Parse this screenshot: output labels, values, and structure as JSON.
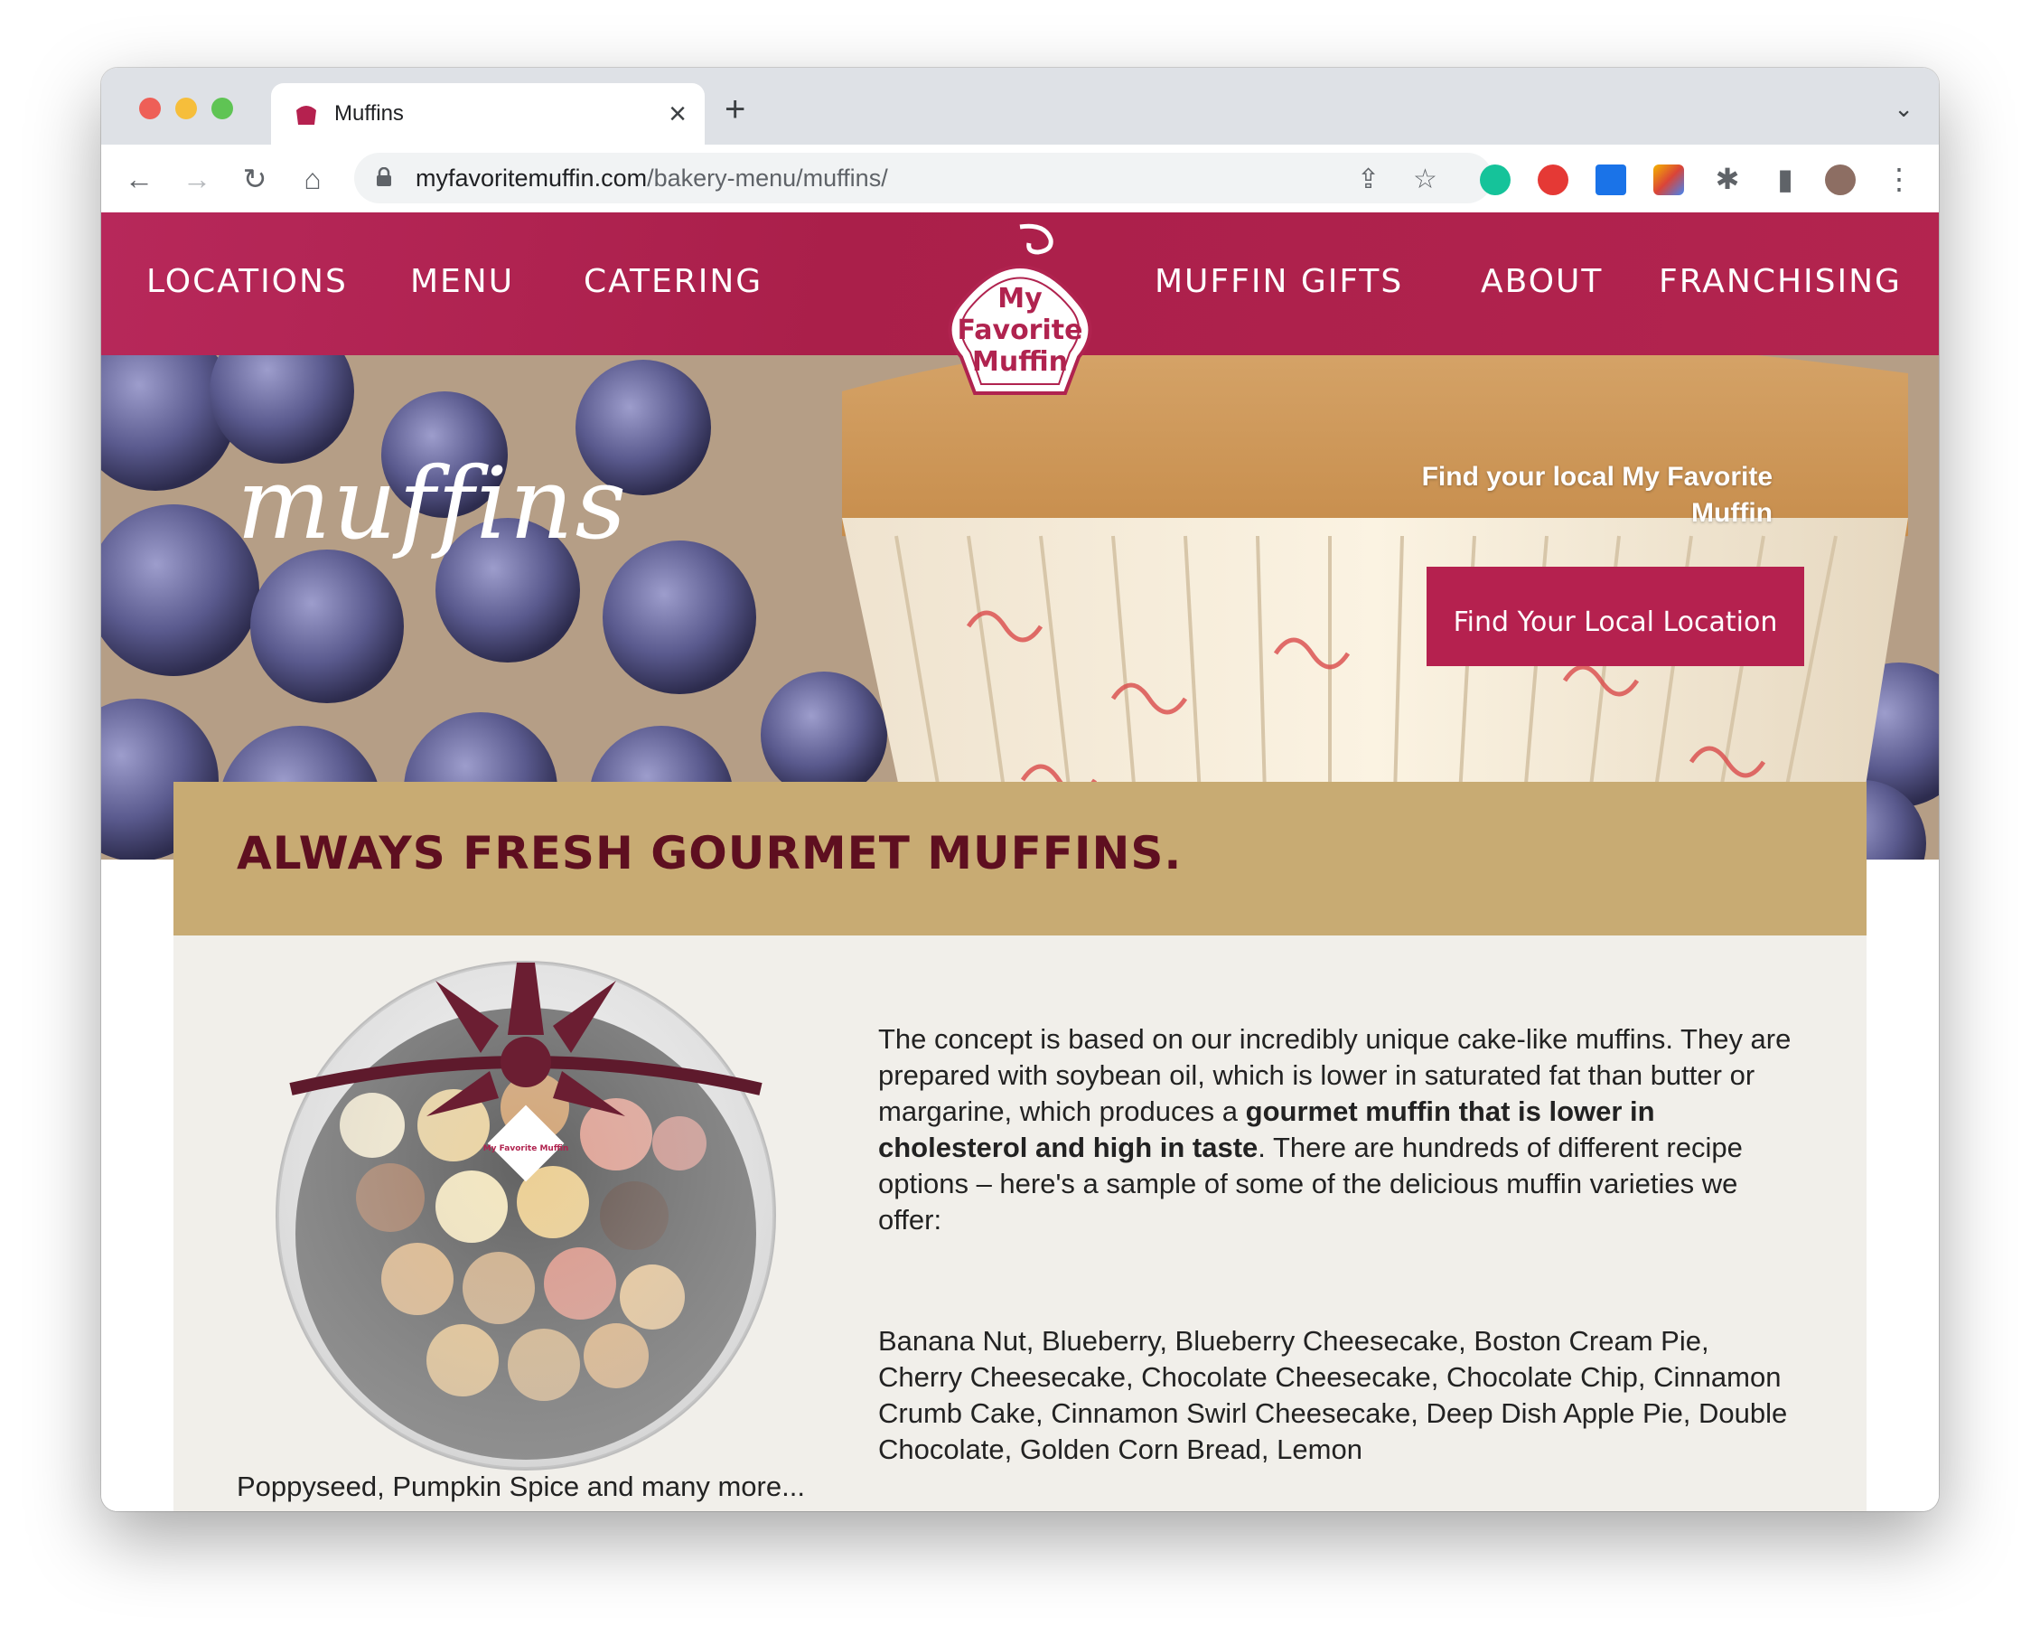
{
  "browser": {
    "tab_title": "Muffins",
    "url_domain": "myfavoritemuffin.com",
    "url_path": "/bakery-menu/muffins/"
  },
  "nav": {
    "locations": "LOCATIONS",
    "menu": "MENU",
    "catering": "CATERING",
    "muffin_gifts": "MUFFIN GIFTS",
    "about": "ABOUT",
    "franchising": "FRANCHISING"
  },
  "logo": {
    "line1": "My",
    "line2": "Favorite",
    "line3": "Muffin"
  },
  "hero": {
    "title": "muffins",
    "find_text": "Find your local My Favorite Muffin",
    "find_button": "Find Your Local Location"
  },
  "content": {
    "heading": "ALWAYS FRESH GOURMET MUFFINS.",
    "desc_part1": "The concept is based on our incredibly unique cake-like muffins. They are prepared with soybean oil, which is lower in saturated fat than butter or margarine, which produces a ",
    "desc_bold": "gourmet muffin that is lower in cholesterol and high in taste",
    "desc_part2": ". There are hundreds of different recipe options – here's a sample of some of the delicious muffin varieties we offer:",
    "varieties": "Banana Nut, Blueberry, Blueberry Cheesecake, Boston Cream Pie, Cherry Cheesecake, Chocolate Cheesecake, Chocolate Chip, Cinnamon Crumb Cake, Cinnamon Swirl Cheesecake, Deep Dish Apple Pie, Double Chocolate, Golden Corn Bread, Lemon",
    "more": "Poppyseed, Pumpkin Spice and many more...",
    "product_tag": "My Favorite Muffin"
  },
  "colors": {
    "brand_primary": "#b0234f",
    "banner": "#c8ab73",
    "heading": "#5e0f20"
  }
}
